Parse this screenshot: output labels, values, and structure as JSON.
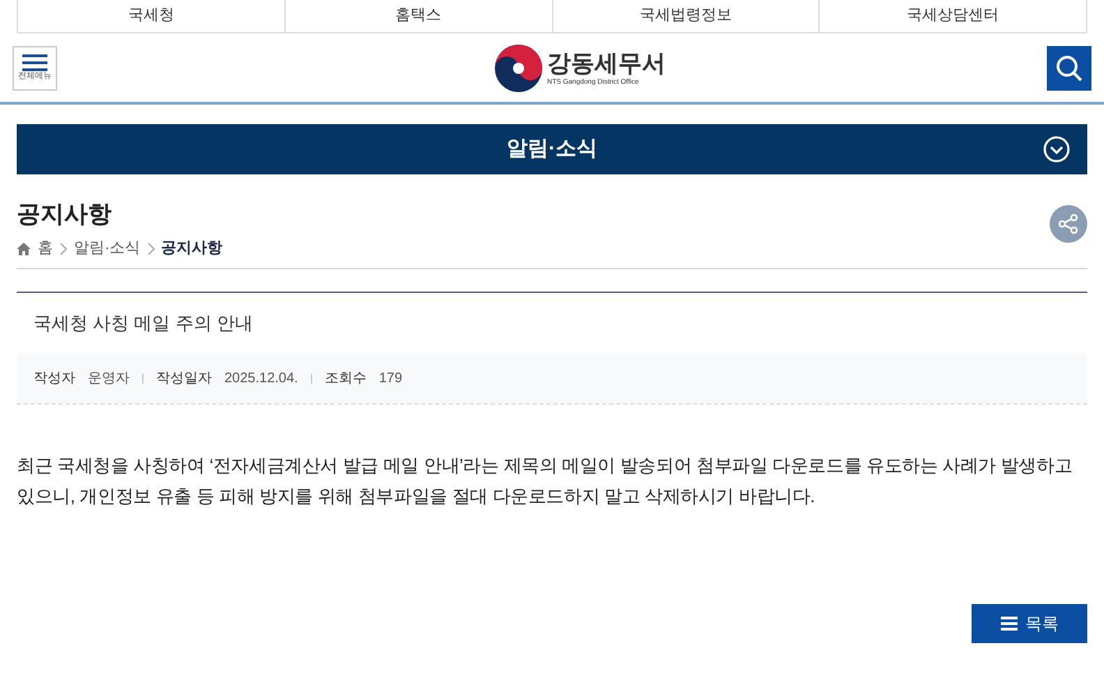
{
  "top_links": [
    "국세청",
    "홈택스",
    "국세법령정보",
    "국세상담센터"
  ],
  "header": {
    "menu_label": "전체메뉴",
    "logo_name": "강동세무서",
    "logo_subtitle": "NTS Gangdong District Office"
  },
  "section_banner": {
    "title": "알림·소식"
  },
  "page": {
    "title": "공지사항",
    "breadcrumb": [
      "홈",
      "알림·소식",
      "공지사항"
    ]
  },
  "post": {
    "title": "국세청 사칭 메일 주의 안내",
    "meta": [
      {
        "label": "작성자",
        "value": "운영자"
      },
      {
        "label": "작성일자",
        "value": "2025.12.04."
      },
      {
        "label": "조회수",
        "value": "179"
      }
    ],
    "body": "최근 국세청을 사칭하여 ‘전자세금계산서 발급 메일 안내’라는 제목의 메일이 발송되어 첨부파일 다운로드를 유도하는 사례가 발생하고 있으니, 개인정보 유출 등 피해 방지를 위해 첨부파일을 절대 다운로드하지 말고 삭제하시기 바랍니다."
  },
  "list_button": "목록"
}
